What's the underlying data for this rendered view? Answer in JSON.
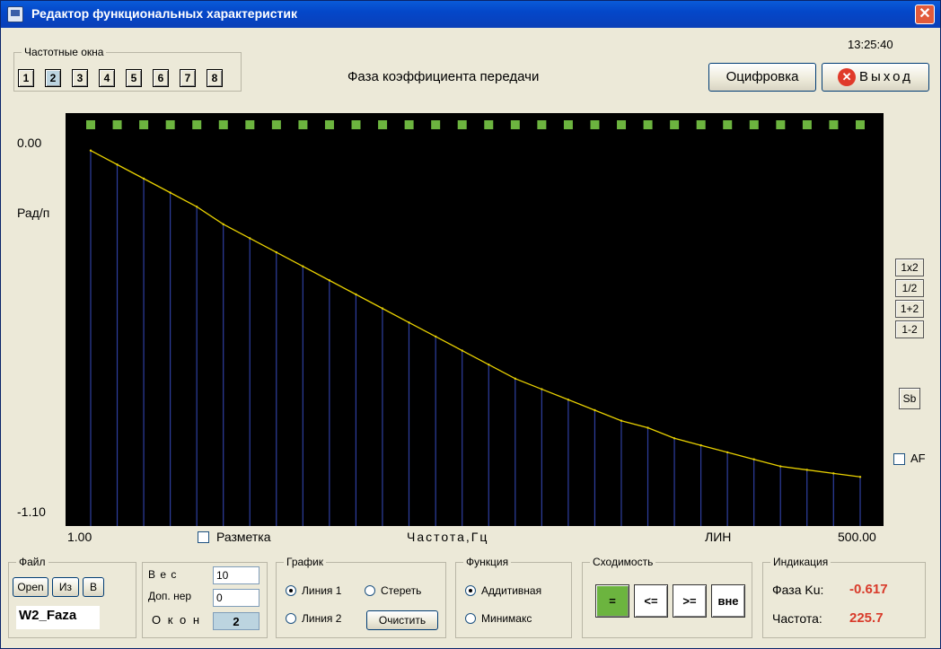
{
  "window": {
    "title": "Редактор функциональных характеристик",
    "close_label": "✕"
  },
  "header": {
    "freq_windows_label": "Частотные окна",
    "freq_buttons": [
      "1",
      "2",
      "3",
      "4",
      "5",
      "6",
      "7",
      "8"
    ],
    "active_window": "2",
    "chart_title": "Фаза коэффициента передачи",
    "time": "13:25:40",
    "digitize_label": "Оцифровка",
    "exit_label": "Выход",
    "exit_icon": "close-circle-icon"
  },
  "chart_data": {
    "type": "line",
    "title": "Фаза коэффициента передачи",
    "xlabel": "Частота,Гц",
    "ylabel": "Рад/п",
    "x_scale_label": "ЛИН",
    "xlim": [
      1.0,
      500.0
    ],
    "ylim": [
      -1.1,
      0.0
    ],
    "x_tick_labels": [
      "1.00",
      "500.00"
    ],
    "y_tick_labels": [
      "0.00",
      "-1.10"
    ],
    "background": "#000000",
    "line_color": "#E8D000",
    "stem_color": "#2E3FA0",
    "marker_color": "#6CB43F",
    "grid": false,
    "x": [
      1.0,
      18.2,
      35.4,
      52.6,
      69.8,
      87.0,
      104.2,
      121.4,
      138.6,
      155.8,
      173.0,
      190.2,
      207.4,
      224.7,
      241.9,
      259.1,
      276.3,
      293.5,
      310.7,
      327.9,
      345.1,
      362.3,
      379.5,
      396.7,
      413.9,
      431.1,
      448.3,
      465.5,
      482.7,
      500.0
    ],
    "y": [
      -0.03,
      -0.07,
      -0.11,
      -0.15,
      -0.19,
      -0.24,
      -0.28,
      -0.32,
      -0.36,
      -0.4,
      -0.44,
      -0.48,
      -0.52,
      -0.56,
      -0.6,
      -0.64,
      -0.68,
      -0.71,
      -0.74,
      -0.77,
      -0.8,
      -0.82,
      -0.85,
      -0.87,
      -0.89,
      -0.91,
      -0.93,
      -0.94,
      -0.95,
      -0.96
    ]
  },
  "plot_marks": {
    "marker_count": 30
  },
  "side": {
    "scale_buttons": [
      "1x2",
      "1/2",
      "1+2",
      "1-2"
    ],
    "sb_label": "Sb",
    "af_label": "AF"
  },
  "markup_check_label": "Разметка",
  "file": {
    "group_label": "Файл",
    "open": "Open",
    "from": "Из",
    "to": "В",
    "filename": "W2_Faza"
  },
  "weights": {
    "weight_label": "В е с",
    "weight_value": "10",
    "extra_label": "Доп. нер",
    "extra_value": "0",
    "windows_label": "О к о н",
    "windows_value": "2"
  },
  "graph": {
    "group_label": "График",
    "line1": "Линия 1",
    "line2": "Линия 2",
    "erase": "Стереть",
    "clear": "Очистить"
  },
  "function": {
    "group_label": "Функция",
    "additive": "Аддитивная",
    "minimax": "Минимакс"
  },
  "convergence": {
    "group_label": "Сходимость",
    "buttons": [
      "=",
      "<=",
      ">=",
      "вне"
    ],
    "active_color": "#6CB43F"
  },
  "indication": {
    "group_label": "Индикация",
    "phase_label": "Фаза Ku:",
    "phase_value": "-0.617",
    "freq_label": "Частота:",
    "freq_value": "225.7",
    "value_color": "#D83A2A"
  }
}
